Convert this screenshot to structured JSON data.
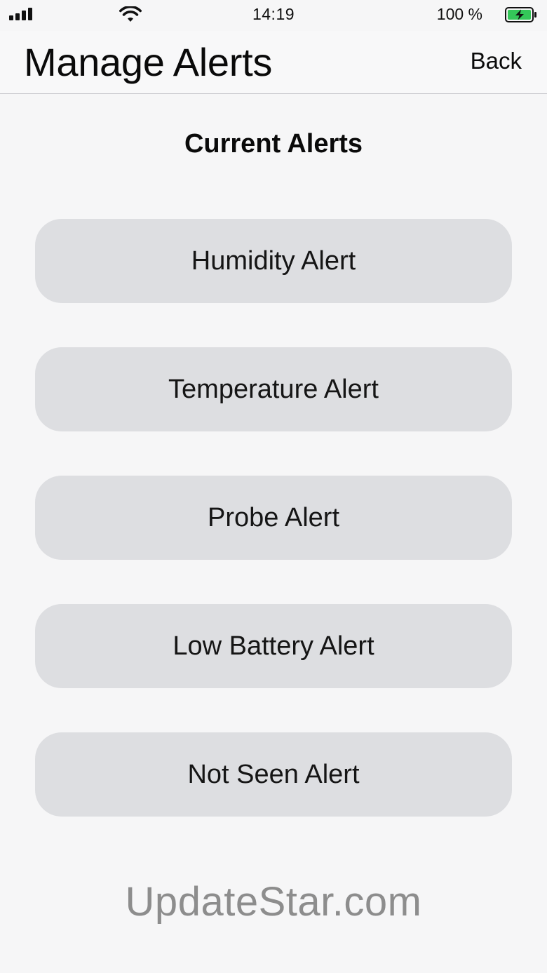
{
  "status_bar": {
    "time": "14:19",
    "battery_percent": "100 %",
    "signal_icon": "cellular-signal-icon",
    "wifi_icon": "wifi-icon",
    "battery_icon": "battery-charging-icon",
    "battery_color": "#34c759"
  },
  "nav": {
    "title": "Manage Alerts",
    "back_label": "Back"
  },
  "main": {
    "section_title": "Current Alerts",
    "alerts": [
      {
        "label": "Humidity Alert"
      },
      {
        "label": "Temperature Alert"
      },
      {
        "label": "Probe Alert"
      },
      {
        "label": "Low Battery Alert"
      },
      {
        "label": "Not Seen Alert"
      }
    ]
  },
  "watermark": "UpdateStar.com",
  "colors": {
    "background": "#f6f6f7",
    "button_background": "#dddee1",
    "watermark": "#8d8d8d"
  }
}
